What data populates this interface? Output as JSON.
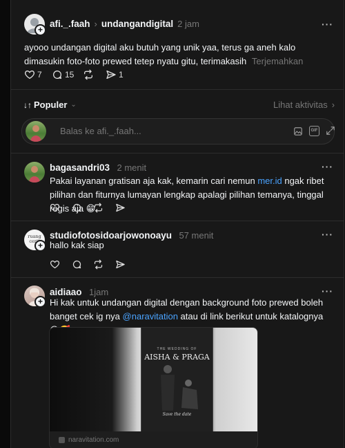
{
  "main_post": {
    "author": "afi._.faah",
    "reply_to": "undangandigital",
    "time": "2 jam",
    "text": "ayooo undangan digital aku butuh yang unik yaa, terus ga aneh kalo dimasukin foto-foto prewed tetep nyatu gitu, terimakasih",
    "translate_label": "Terjemahkan",
    "likes": "7",
    "replies": "15",
    "shares": "1"
  },
  "sort": {
    "label": "Populer",
    "activity_label": "Lihat aktivitas"
  },
  "reply_composer": {
    "placeholder": "Balas ke afi._.faah..."
  },
  "replies": [
    {
      "author": "bagasandri03",
      "time": "2 menit",
      "text_before": "Pakai layanan gratisan aja kak, kemarin cari nemun ",
      "link": "mer.id",
      "text_after": " ngak ribet pilihan dan fiturnya lumayan lengkap apalagi pilihan temanya, tinggal regis aja 😁"
    },
    {
      "author": "studiofotosidoarjowonoayu",
      "avatar_text": "ruang cerit",
      "time": "57 menit",
      "text": "hallo kak siap"
    },
    {
      "author": "aidiaao",
      "time": "1jam",
      "text_before": "Hi kak untuk undangan digital dengan background foto prewed boleh banget cek ig nya ",
      "mention": "@naravitation",
      "text_after": " atau di link berikut untuk katalognya 😊🥰",
      "card_title_small": "THE WEDDING OF",
      "card_names": "AISHA & PRAGA",
      "card_save_date": "Save the date",
      "card_domain": "naravitation.com"
    }
  ],
  "colors": {
    "link": "#4aa3ff",
    "panel": "#181818",
    "page": "#0a0a0a"
  }
}
